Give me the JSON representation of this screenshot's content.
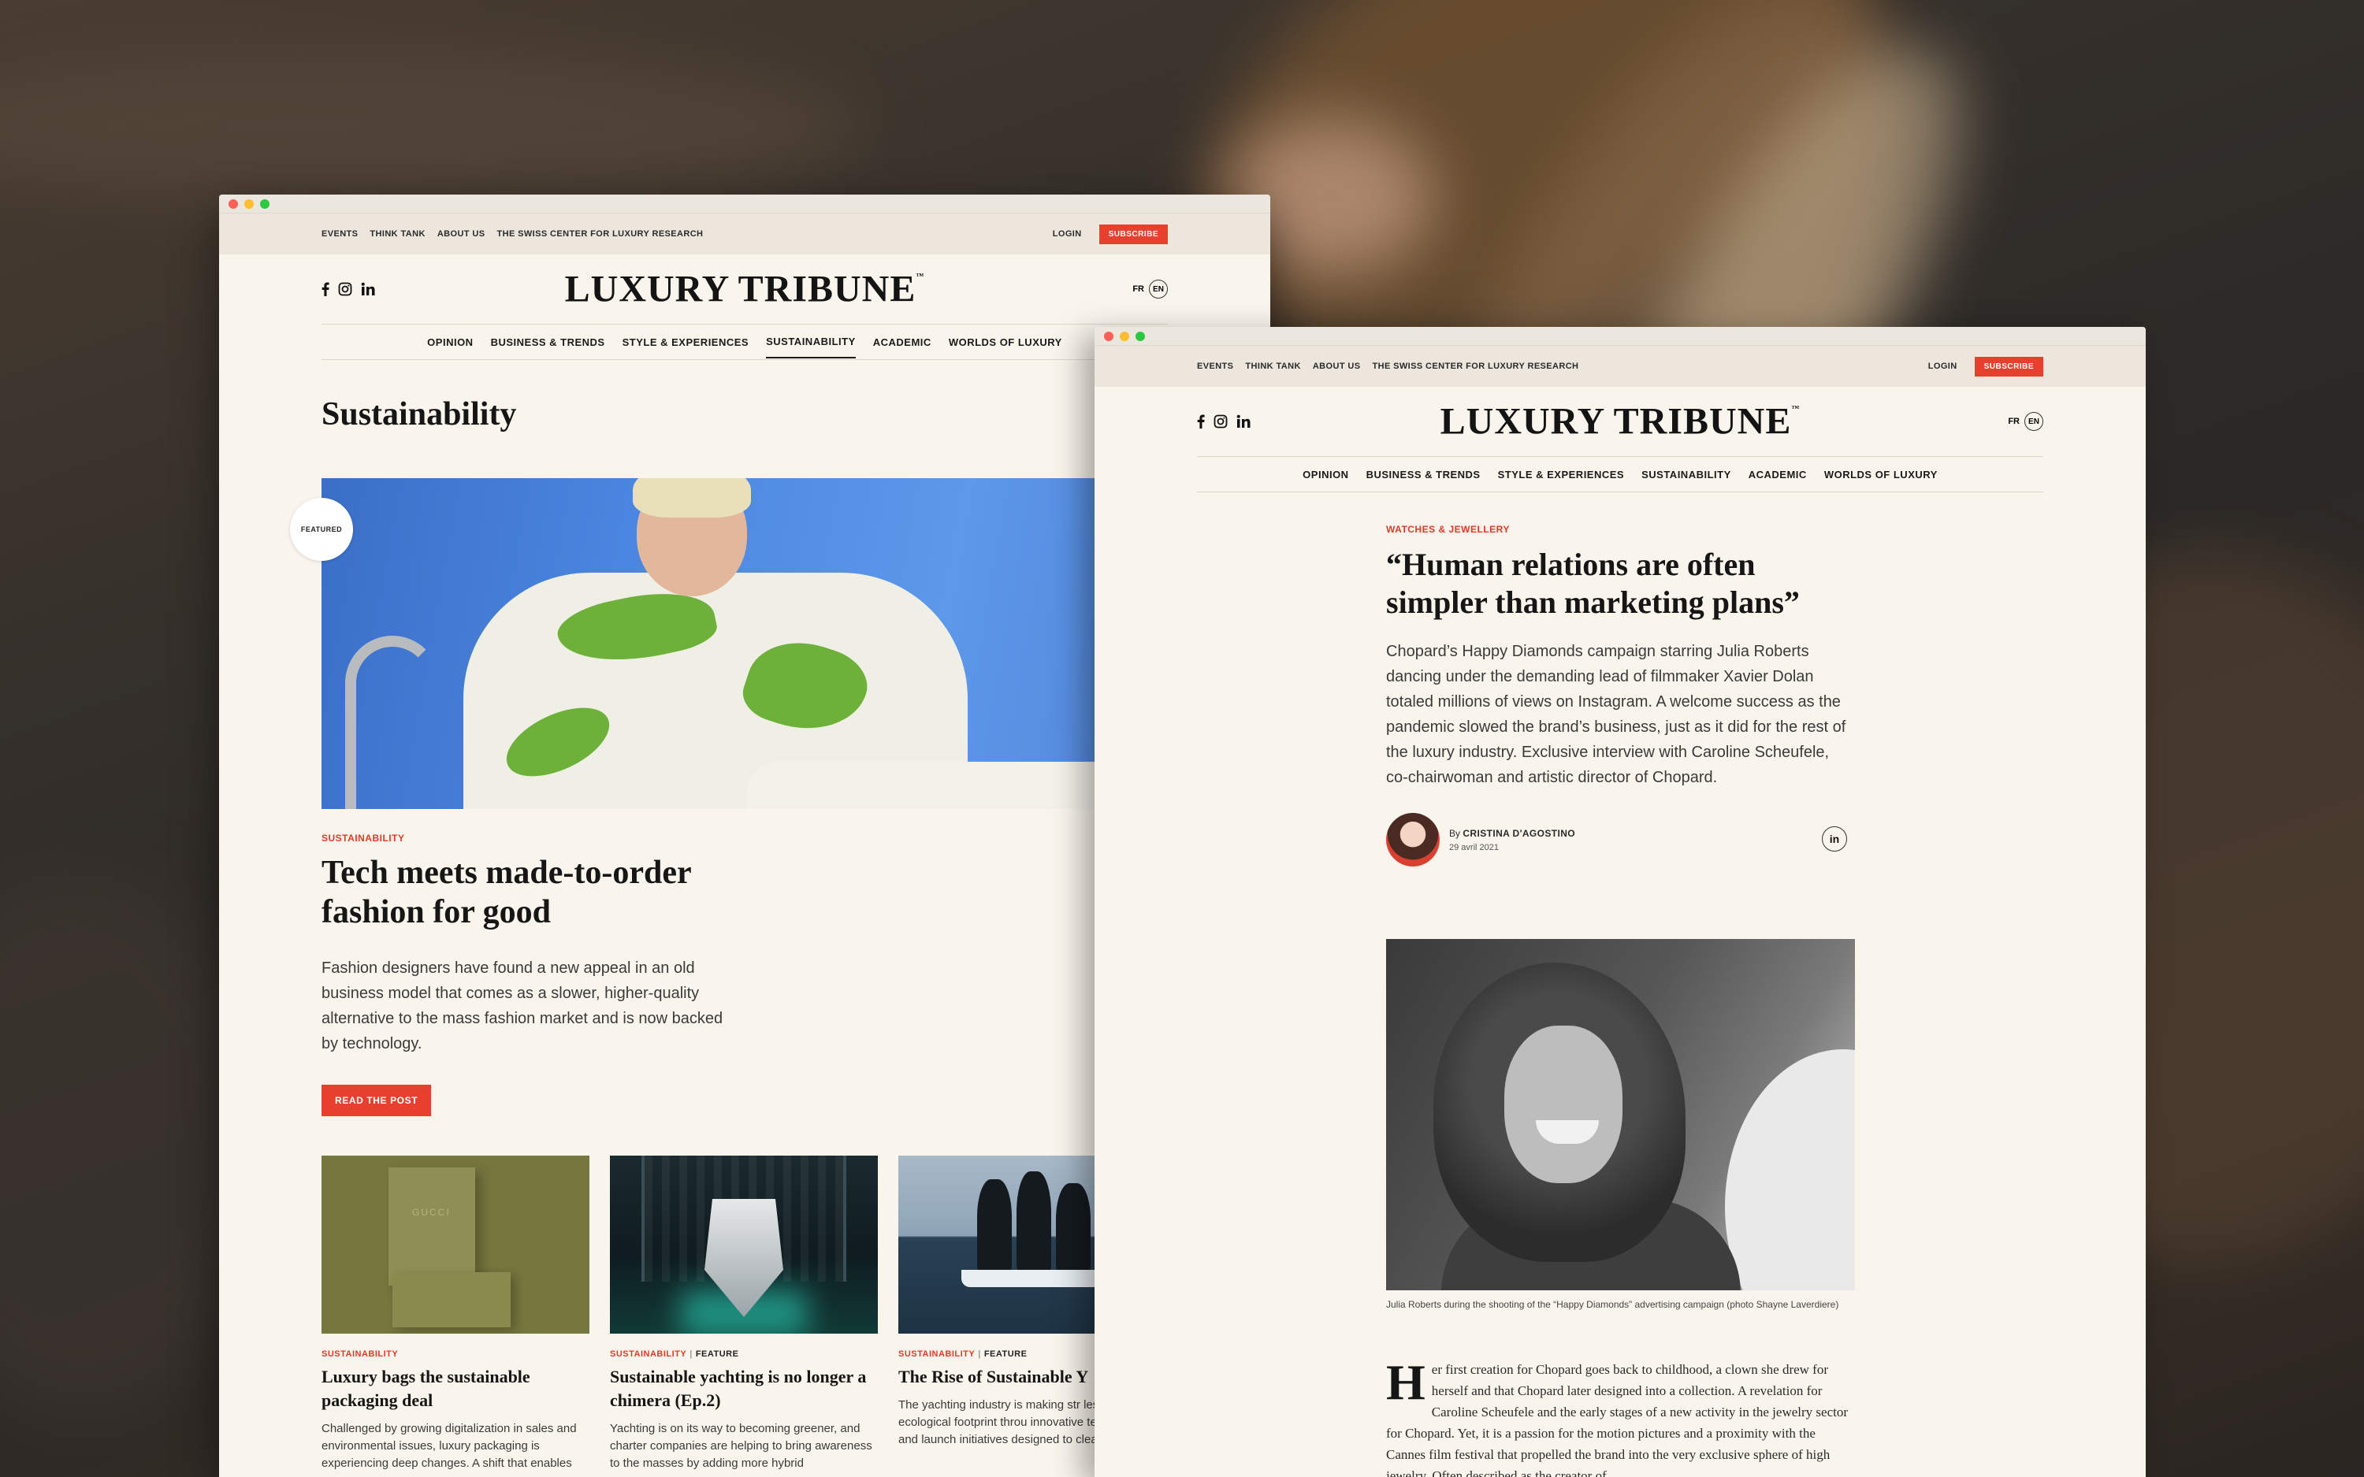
{
  "util_nav": [
    "EVENTS",
    "THINK TANK",
    "ABOUT US",
    "THE SWISS CENTER FOR LUXURY RESEARCH"
  ],
  "login": "LOGIN",
  "subscribe": "SUBSCRIBE",
  "logo": "LUXURY TRIBUNE",
  "logo_tm": "™",
  "lang": {
    "fr": "FR",
    "en": "EN"
  },
  "main_nav": [
    "OPINION",
    "BUSINESS & TRENDS",
    "STYLE & EXPERIENCES",
    "SUSTAINABILITY",
    "ACADEMIC",
    "WORLDS OF LUXURY"
  ],
  "left_page": {
    "section_title": "Sustainability",
    "featured_badge": "FEATURED",
    "hero": {
      "category": "SUSTAINABILITY",
      "title": "Tech meets made-to-order fashion for good",
      "excerpt": "Fashion designers have found a new appeal in an old business model that comes as a slower, higher-quality alternative to the mass fashion market and is now backed by technology.",
      "cta": "READ THE POST"
    },
    "cards": [
      {
        "category": "SUSTAINABILITY",
        "tag": "",
        "title": "Luxury bags the sustainable packaging deal",
        "excerpt": "Challenged by growing digitalization in sales and environmental issues, luxury packaging is experiencing deep changes. A shift that enables",
        "image_text": "GUCCI"
      },
      {
        "category": "SUSTAINABILITY",
        "tag": "FEATURE",
        "title": "Sustainable yachting is no longer a chimera (Ep.2)",
        "excerpt": "Yachting is on its way to becoming greener, and charter companies are helping to bring awareness to the masses by adding more hybrid",
        "image_text": ""
      },
      {
        "category": "SUSTAINABILITY",
        "tag": "FEATURE",
        "title": "The Rise of Sustainable Y",
        "excerpt": "The yachting industry is making str lessen its ecological footprint throu innovative technologies and launch initiatives designed to clean our oce",
        "image_text": ""
      }
    ]
  },
  "right_page": {
    "category": "WATCHES & JEWELLERY",
    "title": "“Human relations are often simpler than marketing plans”",
    "lede": "Chopard’s Happy Diamonds campaign starring Julia Roberts dancing under the demanding lead of filmmaker Xavier Dolan totaled millions of views on Instagram. A welcome success as the pandemic slowed the brand’s business, just as it did for the rest of the luxury industry. Exclusive interview with Caroline Scheufele, co-chairwoman and artistic director of Chopard.",
    "byline_prefix": "By",
    "author": "CRISTINA D'AGOSTINO",
    "date": "29 avril 2021",
    "caption": "Julia Roberts during the shooting of the “Happy Diamonds” advertising campaign (photo Shayne Laverdiere)",
    "dropcap": "H",
    "body": "er first creation for Chopard goes back to childhood, a clown she drew for herself and that Chopard later designed into a collection. A revelation for Caroline Scheufele and the early stages of a new activity in the jewelry sector for Chopard. Yet, it is a passion for the motion pictures and a proximity with the Cannes film festival that propelled the brand into the very exclusive sphere of high jewelry. Often described as the creator of"
  },
  "colors": {
    "accent": "#e8402f",
    "page_bg": "#faf5ec",
    "util_bg": "#ece6dc"
  },
  "icons": [
    "facebook-icon",
    "instagram-icon",
    "linkedin-icon"
  ]
}
